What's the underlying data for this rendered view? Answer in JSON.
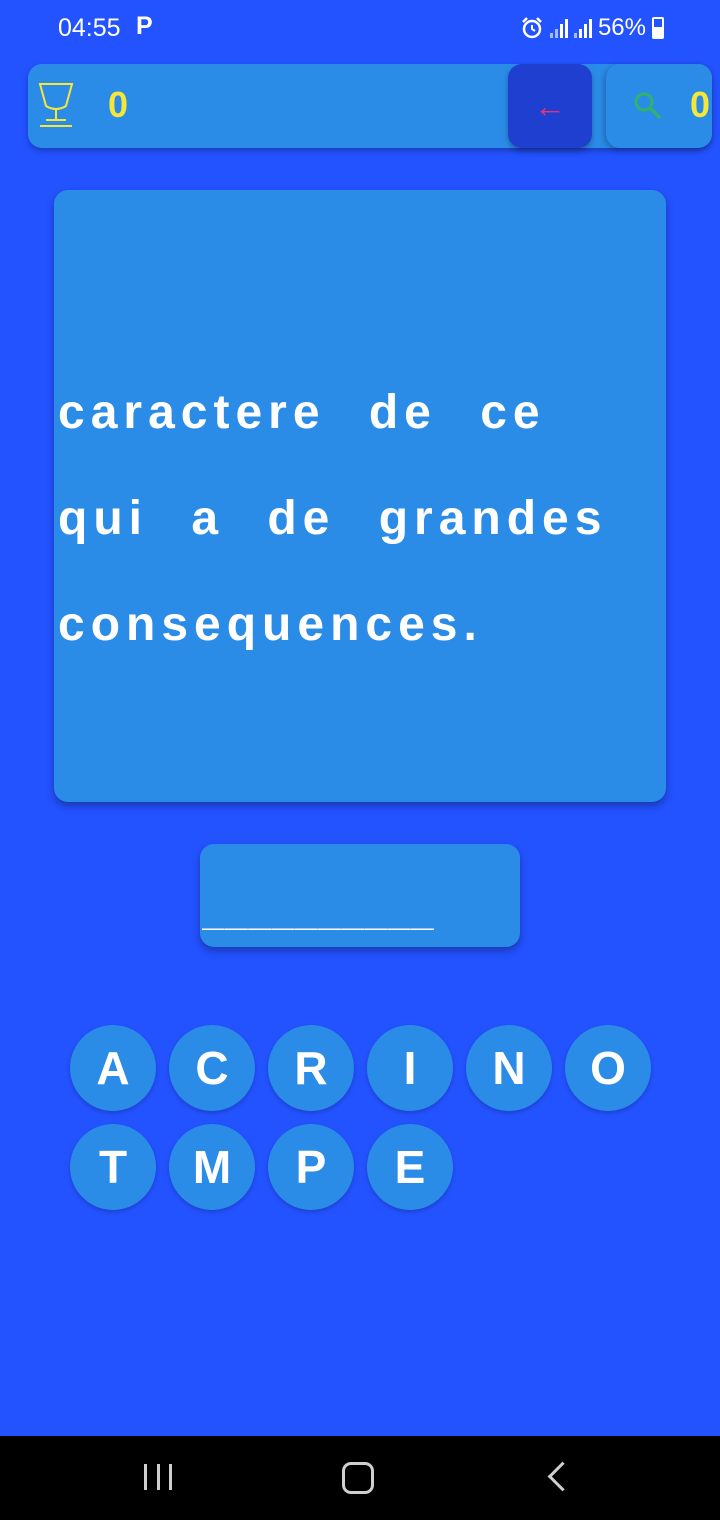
{
  "status_bar": {
    "time": "04:55",
    "notification_glyph": "P",
    "battery_percent": "56%",
    "icons": [
      "alarm-icon",
      "signal-icon",
      "signal-icon",
      "battery-icon"
    ]
  },
  "top_bar": {
    "score": "0",
    "score_icon": "trophy-icon",
    "back_icon": "arrow-left-icon",
    "back_symbol": "←",
    "hint_icon": "search-icon",
    "hint_count": "0"
  },
  "clue": {
    "text": "caractere de ce qui a de grandes consequences."
  },
  "answer": {
    "slots": "__________"
  },
  "keyboard": {
    "row1": [
      "A",
      "C",
      "R",
      "I",
      "N",
      "O"
    ],
    "row2": [
      "T",
      "M",
      "P",
      "E"
    ]
  },
  "nav_bar": {
    "icons": [
      "recent-apps-icon",
      "home-icon",
      "back-icon"
    ]
  },
  "colors": {
    "background": "#2352ff",
    "card": "#2b8ce8",
    "accent_yellow": "#f6e637",
    "back_button": "#1e3fcf",
    "arrow": "#e8327a"
  }
}
